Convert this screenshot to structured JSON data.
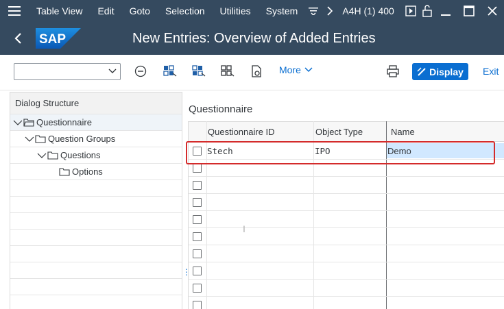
{
  "menubar": {
    "items": [
      "Table View",
      "Edit",
      "Goto",
      "Selection",
      "Utilities",
      "System"
    ],
    "system_id": "A4H (1) 400"
  },
  "titlebar": {
    "logo_text": "SAP",
    "title": "New Entries: Overview of Added Entries"
  },
  "toolbar": {
    "combo_value": "",
    "more_label": "More",
    "display_label": "Display",
    "exit_label": "Exit"
  },
  "dialog_structure": {
    "header": "Dialog Structure",
    "nodes": [
      {
        "label": "Questionnaire",
        "level": 0,
        "selected": true
      },
      {
        "label": "Question Groups",
        "level": 1
      },
      {
        "label": "Questions",
        "level": 2
      },
      {
        "label": "Options",
        "level": 3
      }
    ]
  },
  "questionnaire_table": {
    "title": "Questionnaire",
    "columns": [
      "Questionnaire ID",
      "Object Type",
      "Name"
    ],
    "rows": [
      {
        "questionnaire_id": "Stech",
        "object_type": "IPO",
        "name": "Demo"
      }
    ]
  },
  "colors": {
    "shell": "#354a5f",
    "accent": "#0a6ed1",
    "highlight_border": "#d42b2b"
  }
}
